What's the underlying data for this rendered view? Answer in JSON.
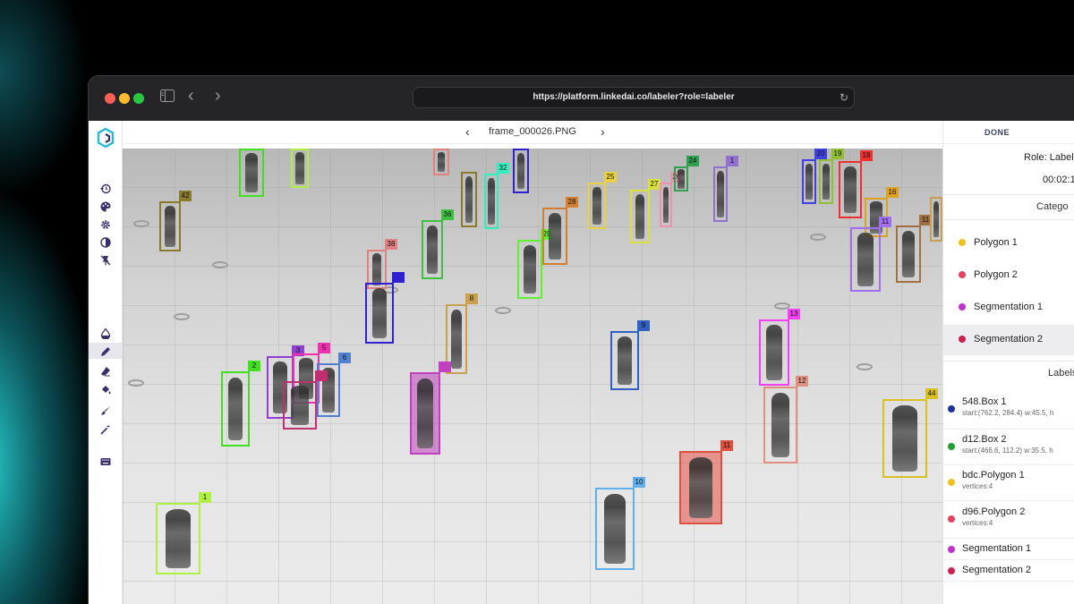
{
  "browser": {
    "url": "https://platform.linkedai.co/labeler?role=labeler",
    "sidebar_icon": "sidebar-icon",
    "back_icon": "‹",
    "forward_icon": "›",
    "reload_icon": "↻"
  },
  "nav": {
    "prev": "‹",
    "next": "›",
    "frame_name": "frame_000026.PNG"
  },
  "panel": {
    "done_label": "DONE",
    "role_text": "Role: Label",
    "timer": "00:02:1",
    "categories_heading": "Catego",
    "labels_heading": "Labels",
    "categories": [
      {
        "label": "Polygon 1",
        "color": "#f0c020"
      },
      {
        "label": "Polygon 2",
        "color": "#e84060"
      },
      {
        "label": "Segmentation 1",
        "color": "#c030d0"
      },
      {
        "label": "Segmentation 2",
        "color": "#d02050"
      }
    ],
    "labels": [
      {
        "name": "548.Box 1",
        "detail": "start:(762.2, 284.4) w:45.5, h",
        "color": "#2030a0"
      },
      {
        "name": "d12.Box 2",
        "detail": "start:(466.6, 112.2) w:35.5, h",
        "color": "#20a030"
      },
      {
        "name": "bdc.Polygon 1",
        "detail": "vertices:4",
        "color": "#f0c020"
      },
      {
        "name": "d96.Polygon 2",
        "detail": "vertices:4",
        "color": "#e84060"
      },
      {
        "name": "Segmentation 1",
        "detail": "",
        "color": "#c030d0"
      },
      {
        "name": "Segmentation 2",
        "detail": "",
        "color": "#d02050"
      }
    ]
  },
  "boxes": [
    {
      "tag": "42",
      "color": "#8a7a30"
    },
    {
      "tag": "2",
      "color": "#40e020"
    },
    {
      "tag": "1",
      "color": "#b0f040"
    },
    {
      "tag": "38",
      "color": "#e08080"
    },
    {
      "tag": "",
      "color": "#3020d0"
    },
    {
      "tag": "8",
      "color": "#c8a050"
    },
    {
      "tag": "36",
      "color": "#40c040"
    },
    {
      "tag": "29",
      "color": "#60f030"
    },
    {
      "tag": "28",
      "color": "#d08030"
    },
    {
      "tag": "25",
      "color": "#e8d040"
    },
    {
      "tag": "27",
      "color": "#d8e040"
    },
    {
      "tag": "26",
      "color": "#f090b0"
    },
    {
      "tag": "24",
      "color": "#30a050"
    },
    {
      "tag": "32",
      "color": "#30f0c0"
    },
    {
      "tag": "1",
      "color": "#9070d0"
    },
    {
      "tag": "9",
      "color": "#3060c0"
    },
    {
      "tag": "13",
      "color": "#f040f0"
    },
    {
      "tag": "12",
      "color": "#e09080"
    },
    {
      "tag": "44",
      "color": "#d8c020"
    },
    {
      "tag": "11",
      "color": "#e05040"
    },
    {
      "tag": "10",
      "color": "#60b0f0"
    },
    {
      "tag": "20",
      "color": "#4040e0"
    },
    {
      "tag": "19",
      "color": "#90c030"
    },
    {
      "tag": "18",
      "color": "#f03030"
    },
    {
      "tag": "16",
      "color": "#e0a020"
    },
    {
      "tag": "11",
      "color": "#a070f0"
    },
    {
      "tag": "11",
      "color": "#a07040"
    },
    {
      "tag": "3",
      "color": "#9040d0"
    },
    {
      "tag": "5",
      "color": "#f030b0"
    },
    {
      "tag": "6",
      "color": "#5080d0"
    },
    {
      "tag": "",
      "color": "#c03070"
    },
    {
      "tag": "",
      "color": "#c040c0"
    }
  ]
}
